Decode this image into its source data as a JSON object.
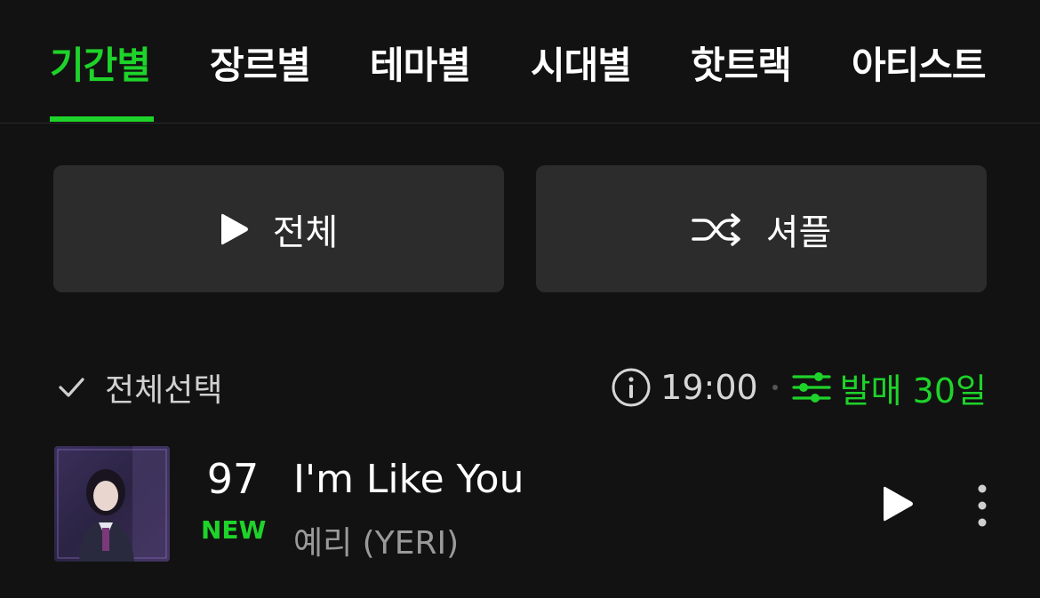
{
  "tabs": [
    {
      "label": "기간별",
      "active": true
    },
    {
      "label": "장르별",
      "active": false
    },
    {
      "label": "테마별",
      "active": false
    },
    {
      "label": "시대별",
      "active": false
    },
    {
      "label": "핫트랙",
      "active": false
    },
    {
      "label": "아티스트",
      "active": false
    }
  ],
  "actions": {
    "play_all_label": "전체",
    "shuffle_label": "셔플"
  },
  "list_controls": {
    "select_all_label": "전체선택",
    "time": "19:00",
    "filter_label": "발매 30일"
  },
  "songs": [
    {
      "rank": "97",
      "badge": "NEW",
      "title": "I'm Like You",
      "artist": "예리 (YERI)",
      "album_art_caption": "I'm Like You"
    }
  ],
  "colors": {
    "accent": "#1ed32a",
    "background": "#121212",
    "button_bg": "#2c2c2c"
  },
  "icons": [
    "play-icon",
    "shuffle-icon",
    "checkmark-icon",
    "info-icon",
    "filter-sliders-icon",
    "more-vertical-icon"
  ]
}
